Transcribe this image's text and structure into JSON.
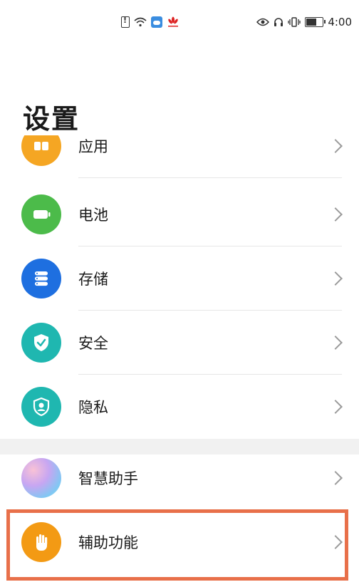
{
  "status_bar": {
    "left_icons": [
      "sim-alert-icon",
      "wifi-icon",
      "weather-app-icon",
      "huawei-notification-icon"
    ],
    "right_icons": [
      "eye-comfort-icon",
      "headset-icon",
      "vibrate-icon",
      "battery-icon"
    ],
    "time": "4:00"
  },
  "page": {
    "title": "设置"
  },
  "list": {
    "partial_item": {
      "label": "应用",
      "icon": "apps-icon",
      "color": "#F5A623"
    },
    "items": [
      {
        "label": "电池",
        "icon": "battery-icon",
        "color": "#4CBB4A"
      },
      {
        "label": "存储",
        "icon": "storage-icon",
        "color": "#1E6FE0"
      },
      {
        "label": "安全",
        "icon": "shield-check-icon",
        "color": "#1FB7B0"
      },
      {
        "label": "隐私",
        "icon": "privacy-icon",
        "color": "#1FB7B0"
      }
    ],
    "section2": [
      {
        "label": "智慧助手",
        "icon": "smart-assistant-icon",
        "color": "#9C7BE8"
      },
      {
        "label": "辅助功能",
        "icon": "hand-icon",
        "color": "#F39A14",
        "highlighted": true
      }
    ]
  },
  "colors": {
    "highlight_border": "#E8704A",
    "section_gap": "#F1F1F1"
  }
}
